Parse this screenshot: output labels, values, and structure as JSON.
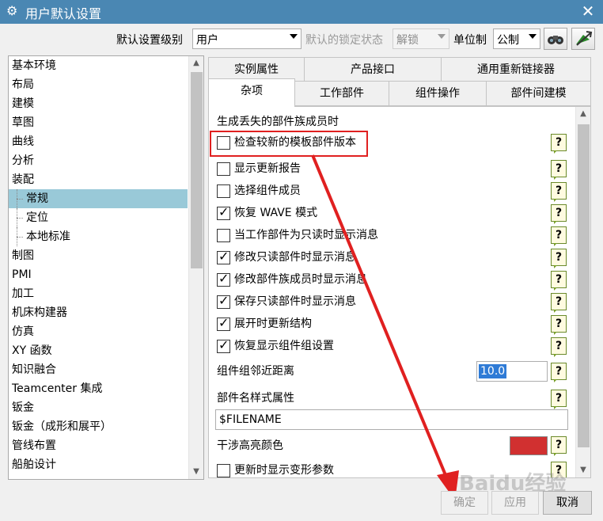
{
  "window": {
    "title": "用户默认设置",
    "close_glyph": "✕"
  },
  "toolbar": {
    "level_label": "默认设置级别",
    "level_value": "用户",
    "lock_label": "默认的锁定状态",
    "lock_value": "解锁",
    "unit_label": "单位制",
    "unit_value": "公制"
  },
  "tree": {
    "items": [
      {
        "label": "基本环境"
      },
      {
        "label": "布局"
      },
      {
        "label": "建模"
      },
      {
        "label": "草图"
      },
      {
        "label": "曲线"
      },
      {
        "label": "分析"
      },
      {
        "label": "装配"
      },
      {
        "label": "常规",
        "selected": true
      },
      {
        "label": "定位"
      },
      {
        "label": "本地标准"
      },
      {
        "label": "制图"
      },
      {
        "label": "PMI"
      },
      {
        "label": "加工"
      },
      {
        "label": "机床构建器"
      },
      {
        "label": "仿真"
      },
      {
        "label": "XY 函数"
      },
      {
        "label": "知识融合"
      },
      {
        "label": "Teamcenter 集成"
      },
      {
        "label": "钣金"
      },
      {
        "label": "钣金（成形和展平）"
      },
      {
        "label": "管线布置"
      },
      {
        "label": "船舶设计"
      }
    ]
  },
  "tabs": {
    "row1": [
      "实例属性",
      "产品接口",
      "通用重新链接器"
    ],
    "row2": [
      "杂项",
      "工作部件",
      "组件操作",
      "部件间建模"
    ],
    "active": "杂项"
  },
  "panel": {
    "group_title": "生成丢失的部件族成员时",
    "checkboxes": [
      {
        "label": "检查较新的模板部件版本",
        "checked": false
      },
      {
        "label": "显示更新报告",
        "checked": false
      },
      {
        "label": "选择组件成员",
        "checked": false
      },
      {
        "label": "恢复 WAVE 模式",
        "checked": true
      },
      {
        "label": "当工作部件为只读时显示消息",
        "checked": false
      },
      {
        "label": "修改只读部件时显示消息",
        "checked": true
      },
      {
        "label": "修改部件族成员时显示消息",
        "checked": true
      },
      {
        "label": "保存只读部件时显示消息",
        "checked": true
      },
      {
        "label": "展开时更新结构",
        "checked": true
      },
      {
        "label": "恢复显示组件组设置",
        "checked": true
      }
    ],
    "neighbor_label": "组件组邻近距离",
    "neighbor_value": "10.0",
    "name_attr_label": "部件名样式属性",
    "name_attr_value": "$FILENAME",
    "interference_label": "干涉高亮颜色",
    "interference_color": "#d13030",
    "last_checkbox": {
      "label": "更新时显示变形参数",
      "checked": false
    },
    "help_glyph": "?"
  },
  "buttons": {
    "ok": "确定",
    "apply": "应用",
    "cancel": "取消"
  },
  "annotation_color": "#e02020"
}
